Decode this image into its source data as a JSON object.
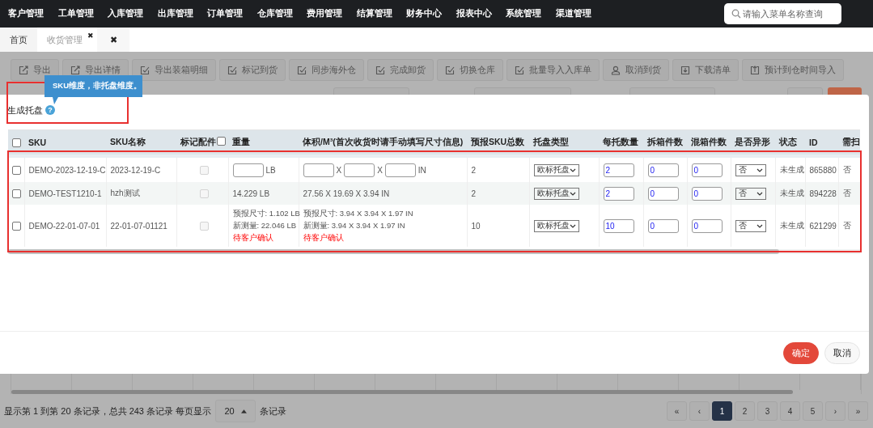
{
  "nav": {
    "items": [
      "客户管理",
      "工单管理",
      "入库管理",
      "出库管理",
      "订单管理",
      "仓库管理",
      "费用管理",
      "结算管理",
      "财务中心",
      "报表中心",
      "系统管理",
      "渠道管理"
    ],
    "search": {
      "placeholder": "请输入菜单名称查询"
    }
  },
  "tabs": [
    {
      "label": "首页",
      "selected": false
    },
    {
      "label": "收货管理",
      "selected": true,
      "close": "✖"
    }
  ],
  "tabs_close_all": "✖",
  "toolbar": [
    {
      "label": "导出",
      "kind": "export"
    },
    {
      "label": "导出详情",
      "kind": "export"
    },
    {
      "label": "导出装箱明细",
      "kind": "mark"
    },
    {
      "label": "标记到货",
      "kind": "mark"
    },
    {
      "label": "同步海外仓",
      "kind": "mark"
    },
    {
      "label": "完成卸货",
      "kind": "mark"
    },
    {
      "label": "切换仓库",
      "kind": "mark"
    },
    {
      "label": "批量导入入库单",
      "kind": "mark"
    },
    {
      "label": "取消到货",
      "kind": "person"
    },
    {
      "label": "下载清单",
      "kind": "download"
    },
    {
      "label": "预计到仓时间导入",
      "kind": "upload"
    }
  ],
  "modal": {
    "title": "生成托盘",
    "help": "?",
    "tooltip": "SKU维度，非托盘维度。",
    "select_all": {
      "checked": false
    },
    "columns": [
      {
        "label": "SKU"
      },
      {
        "label": "SKU名称"
      },
      {
        "label": "标记配件",
        "checked": false
      },
      {
        "label": "重量"
      },
      {
        "label": "体积/M³(首次收货时请手动填写尺寸信息)"
      },
      {
        "label": "预报SKU总数"
      },
      {
        "label": "托盘类型"
      },
      {
        "label": "每托数量"
      },
      {
        "label": "拆箱件数"
      },
      {
        "label": "混箱件数"
      },
      {
        "label": "是否异形"
      },
      {
        "label": "状态"
      },
      {
        "label": "ID"
      },
      {
        "label": "需扫"
      }
    ],
    "rows": [
      {
        "checked": false,
        "sku": "DEMO-2023-12-19-C",
        "name": "2023-12-19-C",
        "accessory": {
          "disabled": true
        },
        "weight": {
          "kind": "input",
          "unit": "LB"
        },
        "volume": {
          "kind": "input",
          "parts": [
            "X",
            "X",
            "IN"
          ]
        },
        "forecast": "2",
        "pallet_type": "欧标托盘",
        "per_pallet": "2",
        "unboxed": "0",
        "mixed": "0",
        "irregular": "否",
        "status": "未生成",
        "id": "865880",
        "need_scan": "否"
      },
      {
        "checked": false,
        "sku": "DEMO-TEST1210-1",
        "name": "hzh测试",
        "accessory": {
          "disabled": true
        },
        "weight": {
          "kind": "text",
          "text": "14.229 LB"
        },
        "volume": {
          "kind": "text",
          "text": "27.56 X 19.69 X 3.94 IN"
        },
        "forecast": "2",
        "pallet_type": "欧标托盘",
        "per_pallet": "2",
        "unboxed": "0",
        "mixed": "0",
        "irregular": "否",
        "status": "未生成",
        "id": "894228",
        "need_scan": "否"
      },
      {
        "checked": false,
        "sku": "DEMO-22-01-07-01",
        "name": "22-01-07-01121",
        "accessory": {
          "disabled": true
        },
        "weight": {
          "kind": "review",
          "lines": [
            "预报尺寸: 1.102 LB",
            "新测量: 22.046 LB"
          ],
          "note": "待客户确认"
        },
        "volume": {
          "kind": "review",
          "lines": [
            "预报尺寸: 3.94 X 3.94 X 1.97 IN",
            "新测量: 3.94 X 3.94 X 1.97 IN"
          ],
          "note": "待客户确认"
        },
        "forecast": "10",
        "pallet_type": "欧标托盘",
        "per_pallet": "10",
        "unboxed": "0",
        "mixed": "0",
        "irregular": "否",
        "status": "未生成",
        "id": "621299",
        "need_scan": "否"
      }
    ],
    "buttons": [
      {
        "label": "确定",
        "kind": "primary"
      },
      {
        "label": "取消",
        "kind": "default"
      }
    ]
  },
  "pagination": {
    "summary": "显示第 1 到第 20 条记录，总共 243 条记录 每页显示",
    "page_size": "20",
    "suffix": "条记录",
    "pages": [
      {
        "label": "«",
        "selected": false
      },
      {
        "label": "‹",
        "selected": false
      },
      {
        "label": "1",
        "selected": true
      },
      {
        "label": "2",
        "selected": false
      },
      {
        "label": "3",
        "selected": false
      },
      {
        "label": "4",
        "selected": false
      },
      {
        "label": "5",
        "selected": false
      },
      {
        "label": "›",
        "selected": false
      },
      {
        "label": "»",
        "selected": false
      }
    ]
  }
}
